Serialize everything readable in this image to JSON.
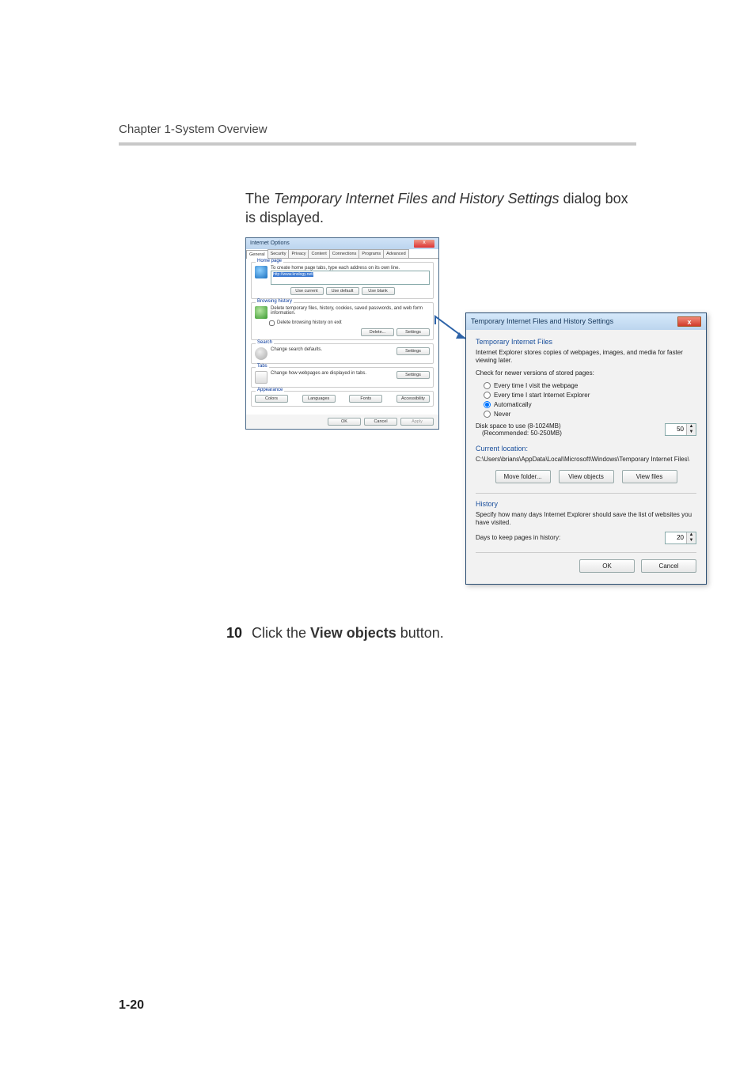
{
  "chapter_header": "Chapter 1-System Overview",
  "intro": {
    "prefix": "The ",
    "italic": "Temporary Internet Files and History Settings",
    "suffix": " dialog box is displayed."
  },
  "io": {
    "title": "Internet Options",
    "close": "x",
    "tabs": [
      "General",
      "Security",
      "Privacy",
      "Content",
      "Connections",
      "Programs",
      "Advanced"
    ],
    "home": {
      "legend": "Home page",
      "text": "To create home page tabs, type each address on its own line.",
      "url": "http://www.knology.net/",
      "use_current": "Use current",
      "use_default": "Use default",
      "use_blank": "Use blank"
    },
    "history": {
      "legend": "Browsing history",
      "text": "Delete temporary files, history, cookies, saved passwords, and web form information.",
      "check": "Delete browsing history on exit",
      "delete": "Delete...",
      "settings": "Settings"
    },
    "search": {
      "legend": "Search",
      "text": "Change search defaults.",
      "settings": "Settings"
    },
    "tabsgrp": {
      "legend": "Tabs",
      "text": "Change how webpages are displayed in tabs.",
      "settings": "Settings"
    },
    "appearance": {
      "legend": "Appearance",
      "colors": "Colors",
      "languages": "Languages",
      "fonts": "Fonts",
      "accessibility": "Accessibility"
    },
    "footer": {
      "ok": "OK",
      "cancel": "Cancel",
      "apply": "Apply"
    }
  },
  "tif": {
    "title": "Temporary Internet Files and History Settings",
    "close": "x",
    "section_head": "Temporary Internet Files",
    "desc": "Internet Explorer stores copies of webpages, images, and media for faster viewing later.",
    "check_label": "Check for newer versions of stored pages:",
    "radios": {
      "r1": "Every time I visit the webpage",
      "r2": "Every time I start Internet Explorer",
      "r3": "Automatically",
      "r4": "Never"
    },
    "disk_label": "Disk space to use (8-1024MB)",
    "disk_rec": "(Recommended: 50-250MB)",
    "disk_value": "50",
    "cur_loc_head": "Current location:",
    "cur_loc_path": "C:\\Users\\brians\\AppData\\Local\\Microsoft\\Windows\\Temporary Internet Files\\",
    "move_folder": "Move folder...",
    "view_objects": "View objects",
    "view_files": "View files",
    "history_head": "History",
    "history_text": "Specify how many days Internet Explorer should save the list of websites you have visited.",
    "days_label": "Days to keep pages in history:",
    "days_value": "20",
    "ok": "OK",
    "cancel": "Cancel"
  },
  "step": {
    "num": "10",
    "prefix": "Click the ",
    "bold": "View objects",
    "suffix": " button."
  },
  "page_number": "1-20"
}
